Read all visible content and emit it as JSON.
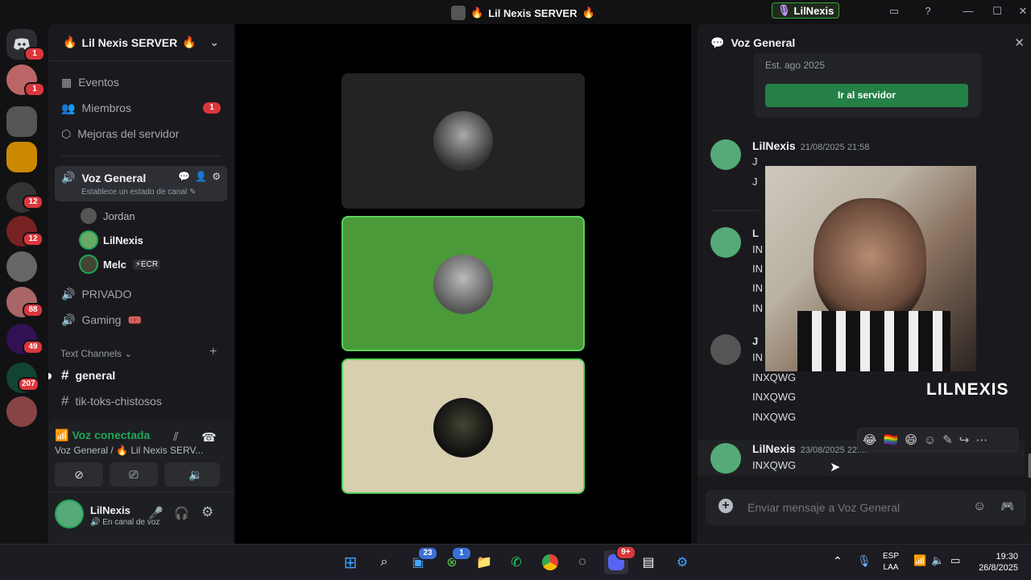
{
  "window": {
    "title": "Lil Nexis SERVER",
    "title_emoji": "🔥",
    "streamer": "LilNexis"
  },
  "rail": {
    "badges": [
      "1",
      "1",
      "12",
      "12",
      "88",
      "49",
      "207"
    ]
  },
  "server": {
    "name": "Lil Nexis SERVER",
    "emoji": "🔥"
  },
  "nav": {
    "events": "Eventos",
    "members": "Miembros",
    "members_badge": "1",
    "boosts": "Mejoras del servidor"
  },
  "voice_channel": {
    "name": "Voz General",
    "status_placeholder": "Establece un estado de canal",
    "users": [
      {
        "name": "Jordan"
      },
      {
        "name": "LilNexis"
      },
      {
        "name": "Melc",
        "tag": "⚡ECR"
      }
    ]
  },
  "channels": {
    "private": "PRIVADO",
    "gaming": "Gaming",
    "gaming_emoji": "🎟️",
    "text_header": "Text Channels",
    "general": "general",
    "tiktoks": "tik-toks-chistosos"
  },
  "voice_status": {
    "connected": "Voz conectada",
    "location": "Voz General / 🔥 Lil Nexis SERV..."
  },
  "user": {
    "name": "LilNexis",
    "status": "En canal de voz"
  },
  "chat": {
    "header": "Voz General",
    "established": "Est. ago 2025",
    "go_server": "Ir al servidor",
    "msg1_author": "LilNexis",
    "msg1_time": "21/08/2025 21:58",
    "msg1_l1": "J",
    "msg1_l2": "J",
    "msg2_l1": "L",
    "msg2_l2": "IN",
    "msg2_l3": "IN",
    "msg2_l4": "IN",
    "msg2_l5": "IN",
    "msg3_l1": "J",
    "msg3_l2": "IN",
    "msg3_l3": "INXQWG",
    "msg3_l4": "INXQWG",
    "msg3_l5": "INXQWG",
    "msg4_author": "LilNexis",
    "msg4_time": "23/08/2025 22:...",
    "msg4_text": "INXQWG",
    "composer_placeholder": "Enviar mensaje a Voz General"
  },
  "webcam": {
    "label": "LILNEXIS"
  },
  "reactions": [
    "😂",
    "🏳️‍🌈",
    "😄"
  ],
  "taskbar": {
    "badge_tasks": "23",
    "badge_xbox": "1",
    "badge_discord": "9+",
    "lang": "ESP",
    "lang2": "LAA",
    "time": "19:30",
    "date": "26/8/2025"
  }
}
